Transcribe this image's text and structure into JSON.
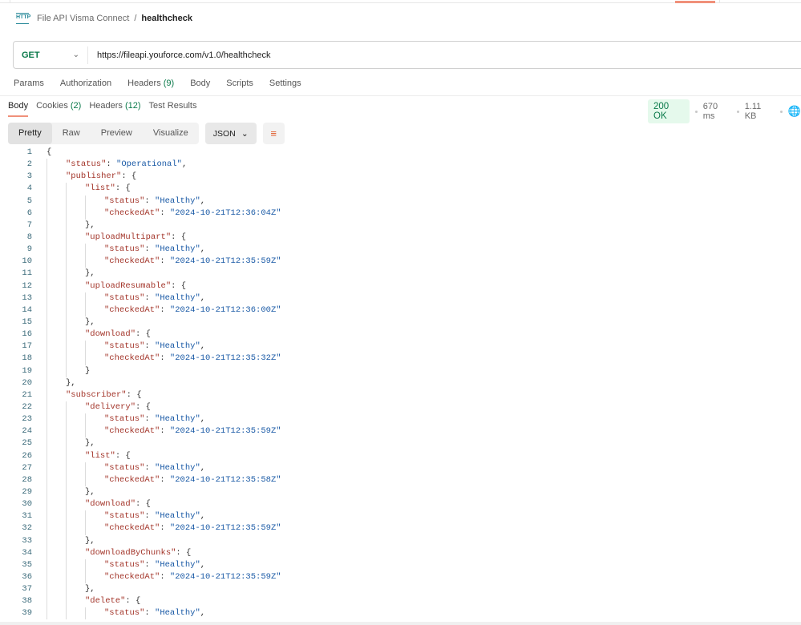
{
  "breadcrumb": {
    "icon": "HTTP",
    "collection": "File API Visma Connect",
    "separator": "/",
    "request": "healthcheck"
  },
  "request": {
    "method": "GET",
    "url": "https://fileapi.youforce.com/v1.0/healthcheck"
  },
  "request_tabs": [
    {
      "label": "Params"
    },
    {
      "label": "Authorization"
    },
    {
      "label": "Headers",
      "count": "(9)"
    },
    {
      "label": "Body"
    },
    {
      "label": "Scripts"
    },
    {
      "label": "Settings"
    }
  ],
  "response_tabs": [
    {
      "label": "Body",
      "active": true
    },
    {
      "label": "Cookies",
      "count": "(2)"
    },
    {
      "label": "Headers",
      "count": "(12)"
    },
    {
      "label": "Test Results"
    }
  ],
  "response_meta": {
    "status": "200 OK",
    "time": "670 ms",
    "size": "1.11 KB",
    "status_color": "#0b7a4b"
  },
  "view_modes": [
    "Pretty",
    "Raw",
    "Preview",
    "Visualize"
  ],
  "format": "JSON",
  "code_lines": [
    {
      "i": 0,
      "t": "{"
    },
    {
      "i": 1,
      "k": "\"status\"",
      "v": "\"Operational\"",
      "t": ","
    },
    {
      "i": 1,
      "k": "\"publisher\"",
      "t": "{"
    },
    {
      "i": 2,
      "k": "\"list\"",
      "t": "{"
    },
    {
      "i": 3,
      "k": "\"status\"",
      "v": "\"Healthy\"",
      "t": ","
    },
    {
      "i": 3,
      "k": "\"checkedAt\"",
      "v": "\"2024-10-21T12:36:04Z\""
    },
    {
      "i": 2,
      "t": "},"
    },
    {
      "i": 2,
      "k": "\"uploadMultipart\"",
      "t": "{"
    },
    {
      "i": 3,
      "k": "\"status\"",
      "v": "\"Healthy\"",
      "t": ","
    },
    {
      "i": 3,
      "k": "\"checkedAt\"",
      "v": "\"2024-10-21T12:35:59Z\""
    },
    {
      "i": 2,
      "t": "},"
    },
    {
      "i": 2,
      "k": "\"uploadResumable\"",
      "t": "{"
    },
    {
      "i": 3,
      "k": "\"status\"",
      "v": "\"Healthy\"",
      "t": ","
    },
    {
      "i": 3,
      "k": "\"checkedAt\"",
      "v": "\"2024-10-21T12:36:00Z\""
    },
    {
      "i": 2,
      "t": "},"
    },
    {
      "i": 2,
      "k": "\"download\"",
      "t": "{"
    },
    {
      "i": 3,
      "k": "\"status\"",
      "v": "\"Healthy\"",
      "t": ","
    },
    {
      "i": 3,
      "k": "\"checkedAt\"",
      "v": "\"2024-10-21T12:35:32Z\""
    },
    {
      "i": 2,
      "t": "}"
    },
    {
      "i": 1,
      "t": "},"
    },
    {
      "i": 1,
      "k": "\"subscriber\"",
      "t": "{"
    },
    {
      "i": 2,
      "k": "\"delivery\"",
      "t": "{"
    },
    {
      "i": 3,
      "k": "\"status\"",
      "v": "\"Healthy\"",
      "t": ","
    },
    {
      "i": 3,
      "k": "\"checkedAt\"",
      "v": "\"2024-10-21T12:35:59Z\""
    },
    {
      "i": 2,
      "t": "},"
    },
    {
      "i": 2,
      "k": "\"list\"",
      "t": "{"
    },
    {
      "i": 3,
      "k": "\"status\"",
      "v": "\"Healthy\"",
      "t": ","
    },
    {
      "i": 3,
      "k": "\"checkedAt\"",
      "v": "\"2024-10-21T12:35:58Z\""
    },
    {
      "i": 2,
      "t": "},"
    },
    {
      "i": 2,
      "k": "\"download\"",
      "t": "{"
    },
    {
      "i": 3,
      "k": "\"status\"",
      "v": "\"Healthy\"",
      "t": ","
    },
    {
      "i": 3,
      "k": "\"checkedAt\"",
      "v": "\"2024-10-21T12:35:59Z\""
    },
    {
      "i": 2,
      "t": "},"
    },
    {
      "i": 2,
      "k": "\"downloadByChunks\"",
      "t": "{"
    },
    {
      "i": 3,
      "k": "\"status\"",
      "v": "\"Healthy\"",
      "t": ","
    },
    {
      "i": 3,
      "k": "\"checkedAt\"",
      "v": "\"2024-10-21T12:35:59Z\""
    },
    {
      "i": 2,
      "t": "},"
    },
    {
      "i": 2,
      "k": "\"delete\"",
      "t": "{"
    },
    {
      "i": 3,
      "k": "\"status\"",
      "v": "\"Healthy\"",
      "t": ","
    }
  ]
}
